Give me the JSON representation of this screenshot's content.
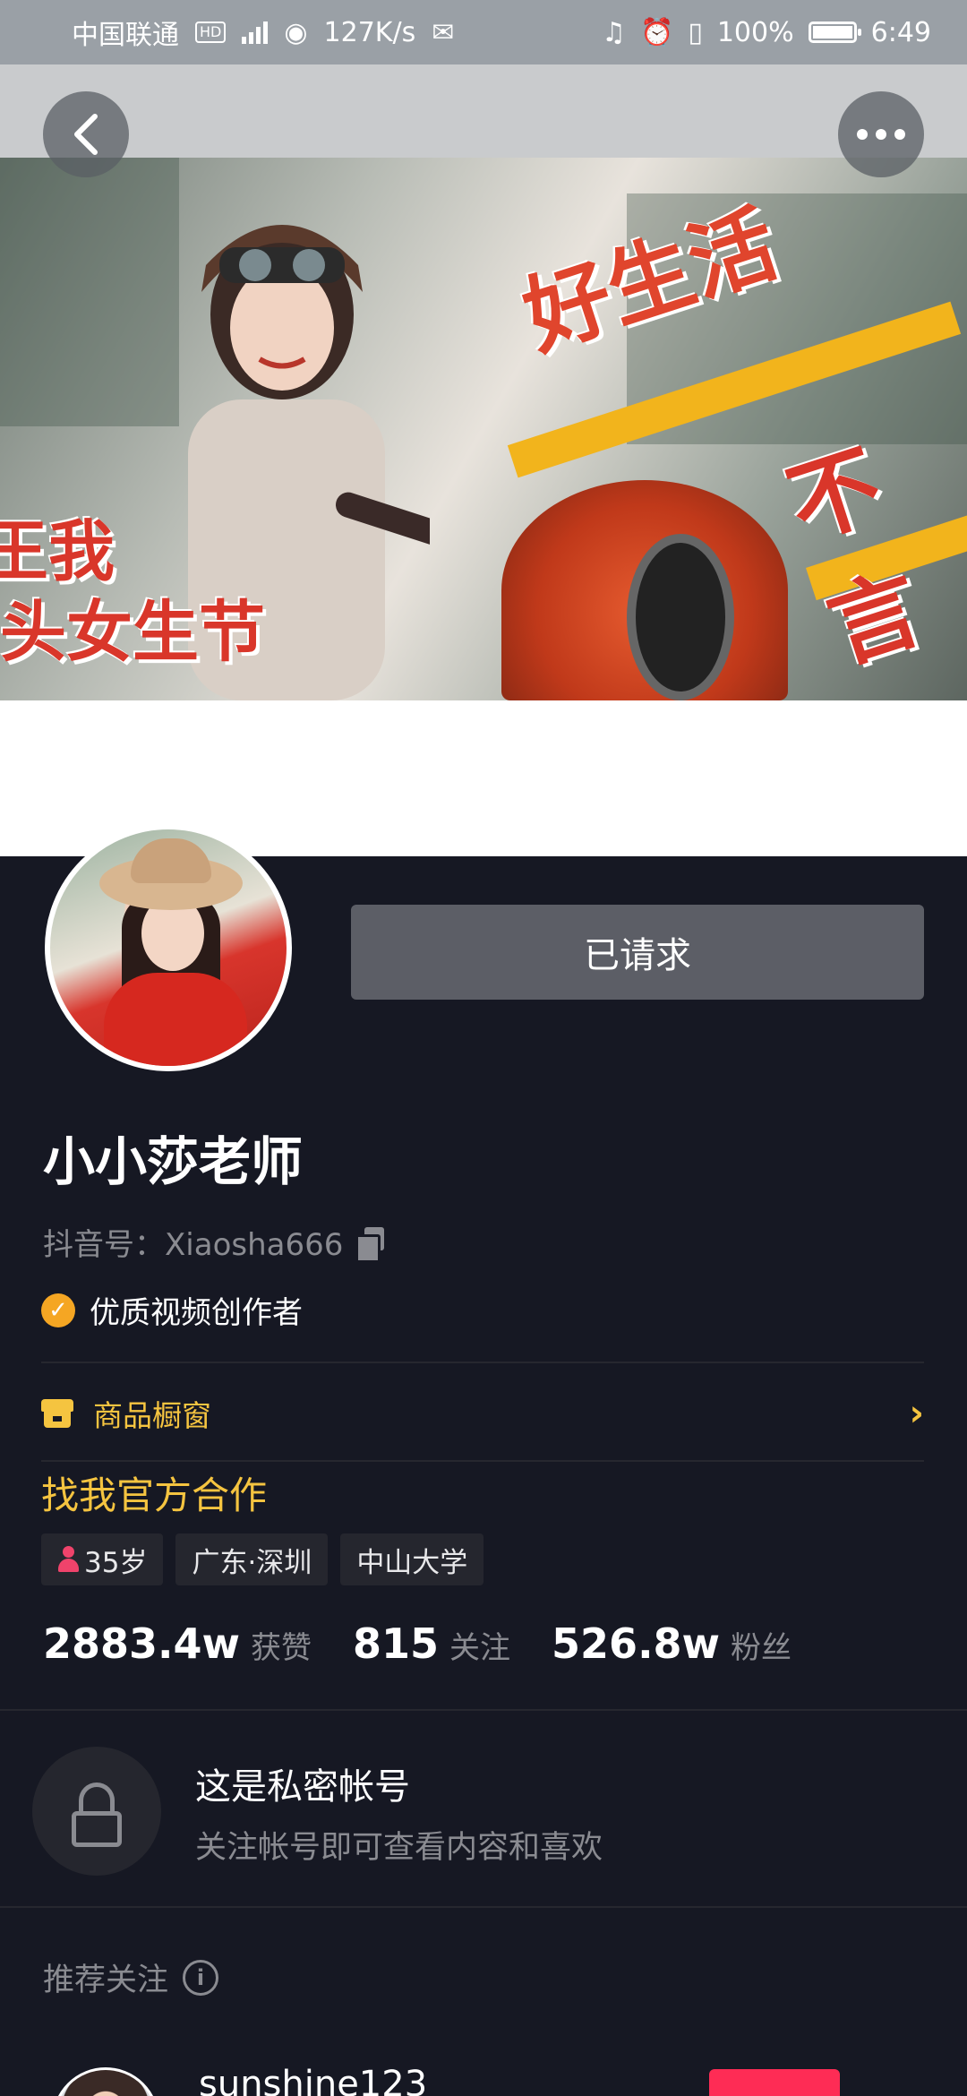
{
  "status_bar": {
    "carrier": "中国联通",
    "hd_badge": "HD",
    "network": "4G",
    "speed": "127K/s",
    "battery_level": 100,
    "battery_text": "100%",
    "time": "6:49"
  },
  "cover": {
    "text_1": "好生活",
    "text_2": "王我",
    "text_3": "头女生节",
    "text_4": "不言"
  },
  "profile": {
    "follow_state_label": "已请求",
    "nickname": "小小莎老师",
    "douyin_id_label": "抖音号：Xiaosha666",
    "verification": "优质视频创作者",
    "shop_label": "商品橱窗",
    "cooperation": "找我官方合作",
    "tags": {
      "age": "35岁",
      "location": "广东·深圳",
      "school": "中山大学"
    },
    "stats": {
      "likes_value": "2883.4w",
      "likes_label": "获赞",
      "following_value": "815",
      "following_label": "关注",
      "followers_value": "526.8w",
      "followers_label": "粉丝"
    }
  },
  "private": {
    "title": "这是私密帐号",
    "description": "关注帐号即可查看内容和喜欢"
  },
  "recommend": {
    "header": "推荐关注",
    "first_name": "sunshine123"
  },
  "colors": {
    "background": "#161823",
    "accent_yellow": "#f5c440",
    "follow_red": "#fe2c55",
    "requested_gray": "#5c5e66"
  }
}
